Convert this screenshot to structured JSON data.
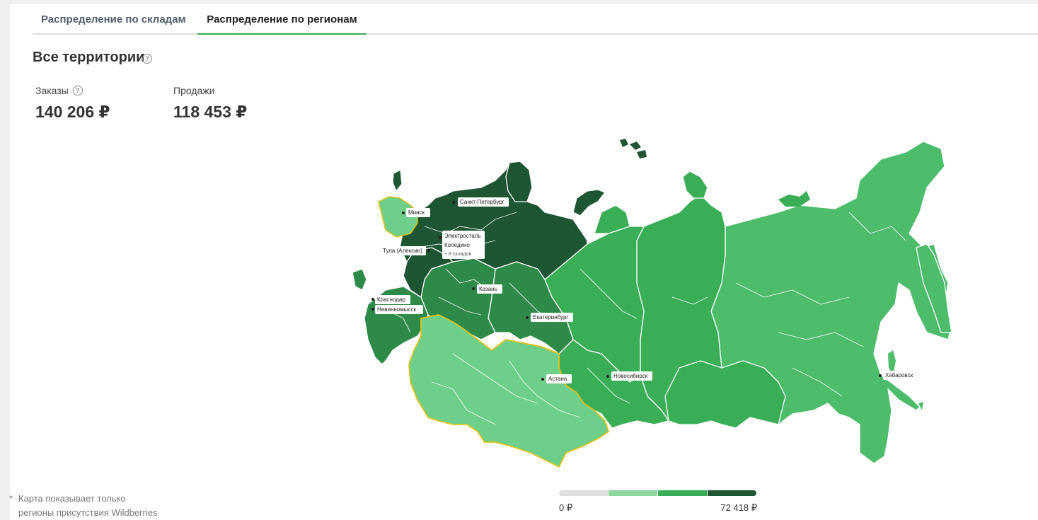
{
  "tabs": [
    {
      "label": "Распределение по складам",
      "active": false
    },
    {
      "label": "Распределение по регионам",
      "active": true
    }
  ],
  "title": "Все территории",
  "metrics": {
    "orders": {
      "label": "Заказы",
      "value": "140 206 ₽"
    },
    "sales": {
      "label": "Продажи",
      "value": "118 453 ₽"
    }
  },
  "footnote": {
    "star": "*",
    "line1": "Карта показывает только",
    "line2": "регионы присутствия Wildberries"
  },
  "legend": {
    "min": "0 ₽",
    "max": "72 418 ₽",
    "colors": [
      "#e0e0e0",
      "#8fd5a0",
      "#3aae57",
      "#1e5533"
    ]
  },
  "map": {
    "colors": {
      "darkest": "#1e5533",
      "dark": "#2e8a48",
      "medium": "#3aae57",
      "light": "#4dbd6b",
      "lightest": "#6dcf8a",
      "border_highlight": "#e0c21a"
    },
    "cities": {
      "spb": "Санкт-Петербург",
      "minsk": "Минск",
      "elektrostal": "Электросталь",
      "koledino": "Коледино",
      "more": "+ 8 складов",
      "tula": "Тула (Алексин)",
      "kazan": "Казань",
      "krasnodar": "Краснодар",
      "nevinnomyssk": "Невинномысск",
      "ekaterinburg": "Екатеринбург",
      "novosibirsk": "Новосибирск",
      "astana": "Астана",
      "khabarovsk": "Хабаровск"
    }
  }
}
